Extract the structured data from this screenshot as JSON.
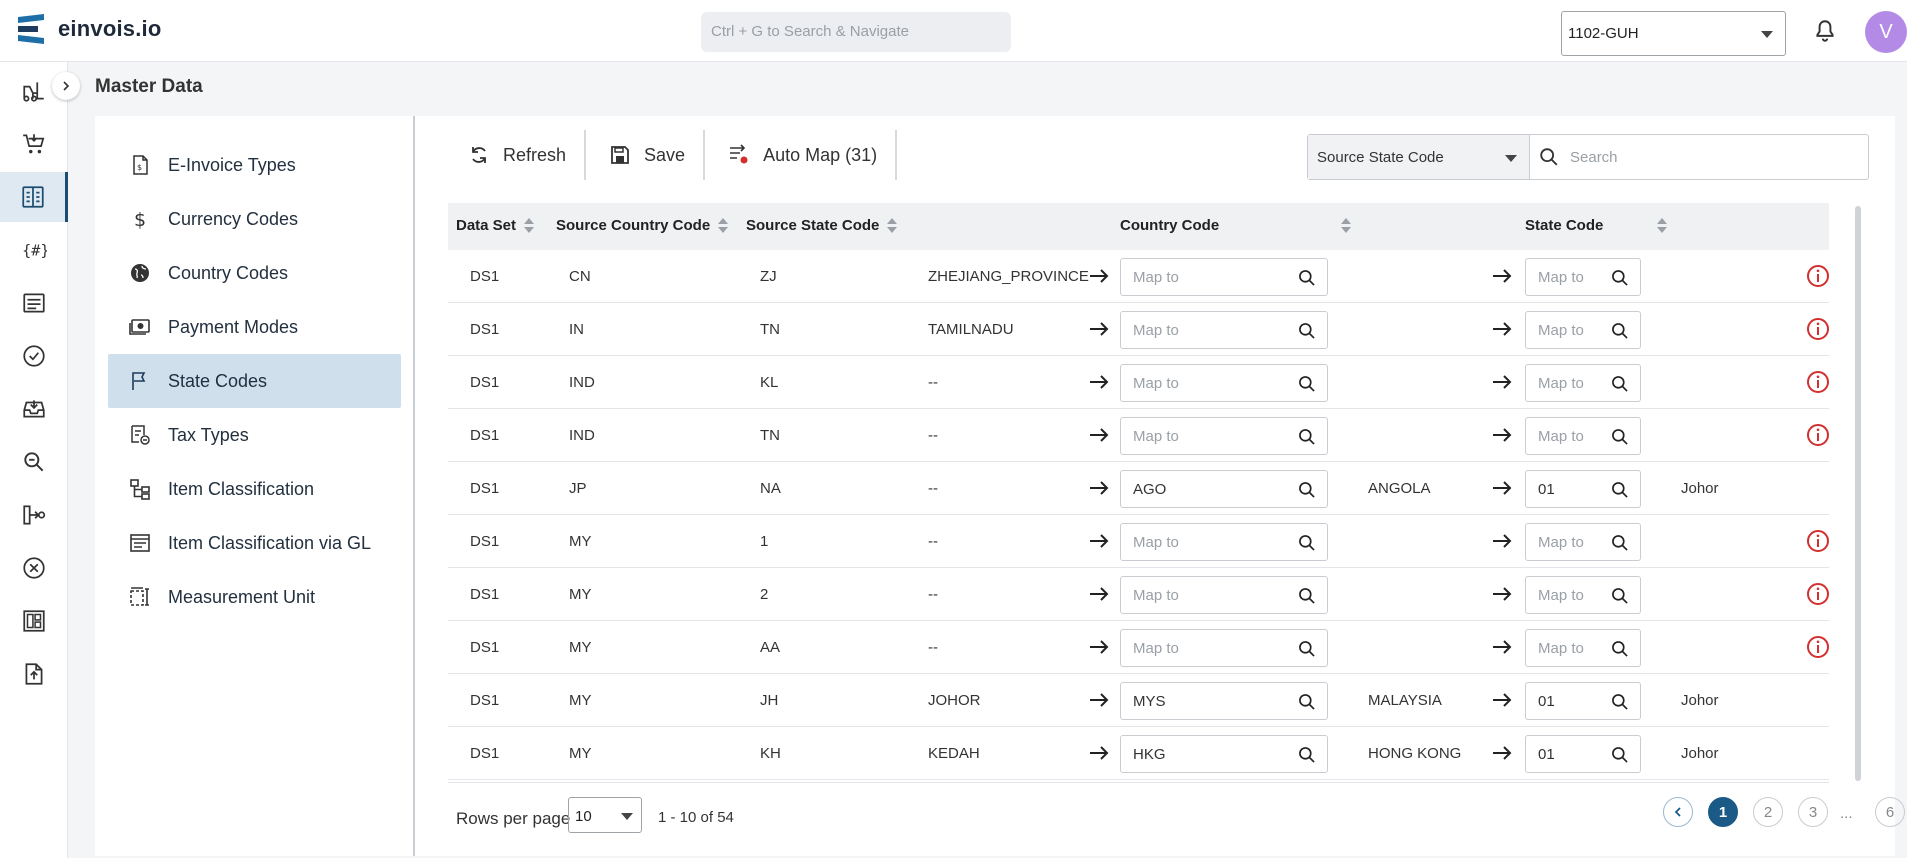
{
  "app": {
    "brand": "einvois.io",
    "search_placeholder": "Ctrl + G to Search & Navigate",
    "company": "1102-GUH",
    "avatar_initial": "V"
  },
  "page": {
    "title": "Master Data"
  },
  "menu": [
    {
      "label": "E-Invoice Types",
      "icon": "invoice-icon"
    },
    {
      "label": "Currency Codes",
      "icon": "dollar-icon"
    },
    {
      "label": "Country Codes",
      "icon": "globe-icon"
    },
    {
      "label": "Payment Modes",
      "icon": "payment-icon"
    },
    {
      "label": "State Codes",
      "icon": "flag-icon",
      "active": true
    },
    {
      "label": "Tax Types",
      "icon": "tax-icon"
    },
    {
      "label": "Item Classification",
      "icon": "hierarchy-icon"
    },
    {
      "label": "Item Classification via GL",
      "icon": "list-icon"
    },
    {
      "label": "Measurement Unit",
      "icon": "measure-icon"
    }
  ],
  "toolbar": {
    "refresh": "Refresh",
    "save": "Save",
    "auto_map": "Auto Map (31)"
  },
  "filter": {
    "field": "Source State Code",
    "search_placeholder": "Search"
  },
  "table": {
    "headers": {
      "dataset": "Data Set",
      "src_country": "Source Country Code",
      "src_state": "Source State Code",
      "country": "Country Code",
      "state": "State Code"
    },
    "map_placeholder": "Map to",
    "rows": [
      {
        "ds": "DS1",
        "sc": "CN",
        "ss": "ZJ",
        "sname": "ZHEJIANG_PROVINCE",
        "country": "",
        "cname": "",
        "state": "",
        "stname": "",
        "warn": true
      },
      {
        "ds": "DS1",
        "sc": "IN",
        "ss": "TN",
        "sname": "TAMILNADU",
        "country": "",
        "cname": "",
        "state": "",
        "stname": "",
        "warn": true
      },
      {
        "ds": "DS1",
        "sc": "IND",
        "ss": "KL",
        "sname": "--",
        "country": "",
        "cname": "",
        "state": "",
        "stname": "",
        "warn": true
      },
      {
        "ds": "DS1",
        "sc": "IND",
        "ss": "TN",
        "sname": "--",
        "country": "",
        "cname": "",
        "state": "",
        "stname": "",
        "warn": true
      },
      {
        "ds": "DS1",
        "sc": "JP",
        "ss": "NA",
        "sname": "--",
        "country": "AGO",
        "cname": "ANGOLA",
        "state": "01",
        "stname": "Johor",
        "warn": false
      },
      {
        "ds": "DS1",
        "sc": "MY",
        "ss": "1",
        "sname": "--",
        "country": "",
        "cname": "",
        "state": "",
        "stname": "",
        "warn": true
      },
      {
        "ds": "DS1",
        "sc": "MY",
        "ss": "2",
        "sname": "--",
        "country": "",
        "cname": "",
        "state": "",
        "stname": "",
        "warn": true
      },
      {
        "ds": "DS1",
        "sc": "MY",
        "ss": "AA",
        "sname": "--",
        "country": "",
        "cname": "",
        "state": "",
        "stname": "",
        "warn": true
      },
      {
        "ds": "DS1",
        "sc": "MY",
        "ss": "JH",
        "sname": "JOHOR",
        "country": "MYS",
        "cname": "MALAYSIA",
        "state": "01",
        "stname": "Johor",
        "warn": false
      },
      {
        "ds": "DS1",
        "sc": "MY",
        "ss": "KH",
        "sname": "KEDAH",
        "country": "HKG",
        "cname": "HONG KONG",
        "state": "01",
        "stname": "Johor",
        "warn": false
      }
    ]
  },
  "pagination": {
    "rows_label": "Rows per page",
    "rows_value": "10",
    "range": "1 - 10 of 54",
    "pages": [
      "1",
      "2",
      "3",
      "6"
    ],
    "ellipsis": "...",
    "current": "1"
  },
  "colors": {
    "accent": "#1b5a86",
    "warning": "#d32f2f",
    "active_menu": "#cfe0ec"
  }
}
